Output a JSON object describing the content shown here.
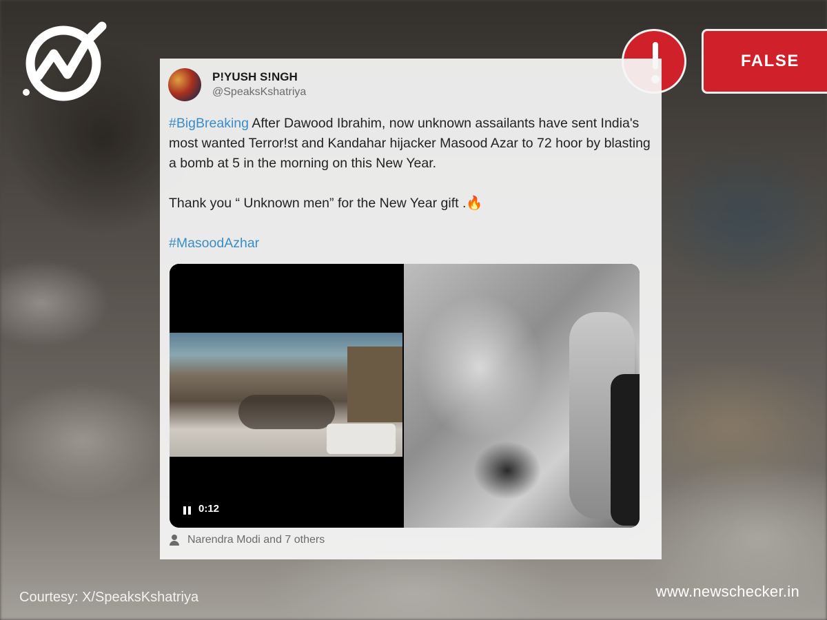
{
  "brand": {
    "logo_icon": "newschecker-check-icon",
    "site": "www.newschecker.in"
  },
  "verdict": {
    "icon": "exclamation-icon",
    "label": "FALSE",
    "color": "#d0202a"
  },
  "tweet": {
    "name": "P!YUSH S!NGH",
    "handle": "@SpeaksKshatriya",
    "hashtag_1": "#BigBreaking",
    "text_1": " After Dawood Ibrahim, now unknown assailants have sent India's most wanted Terror!st and Kandahar hijacker Masood Azar to 72 hoor by blasting a bomb at 5 in the morning on this New Year.",
    "text_2": "Thank you “ Unknown men” for the New Year gift .",
    "emoji": "🔥",
    "hashtag_2": "#MasoodAzhar",
    "video_time": "0:12",
    "liked_by": "Narendra Modi and 7 others",
    "hashtag_color": "#3a8cc8"
  },
  "courtesy": "Courtesy: X/SpeaksKshatriya"
}
